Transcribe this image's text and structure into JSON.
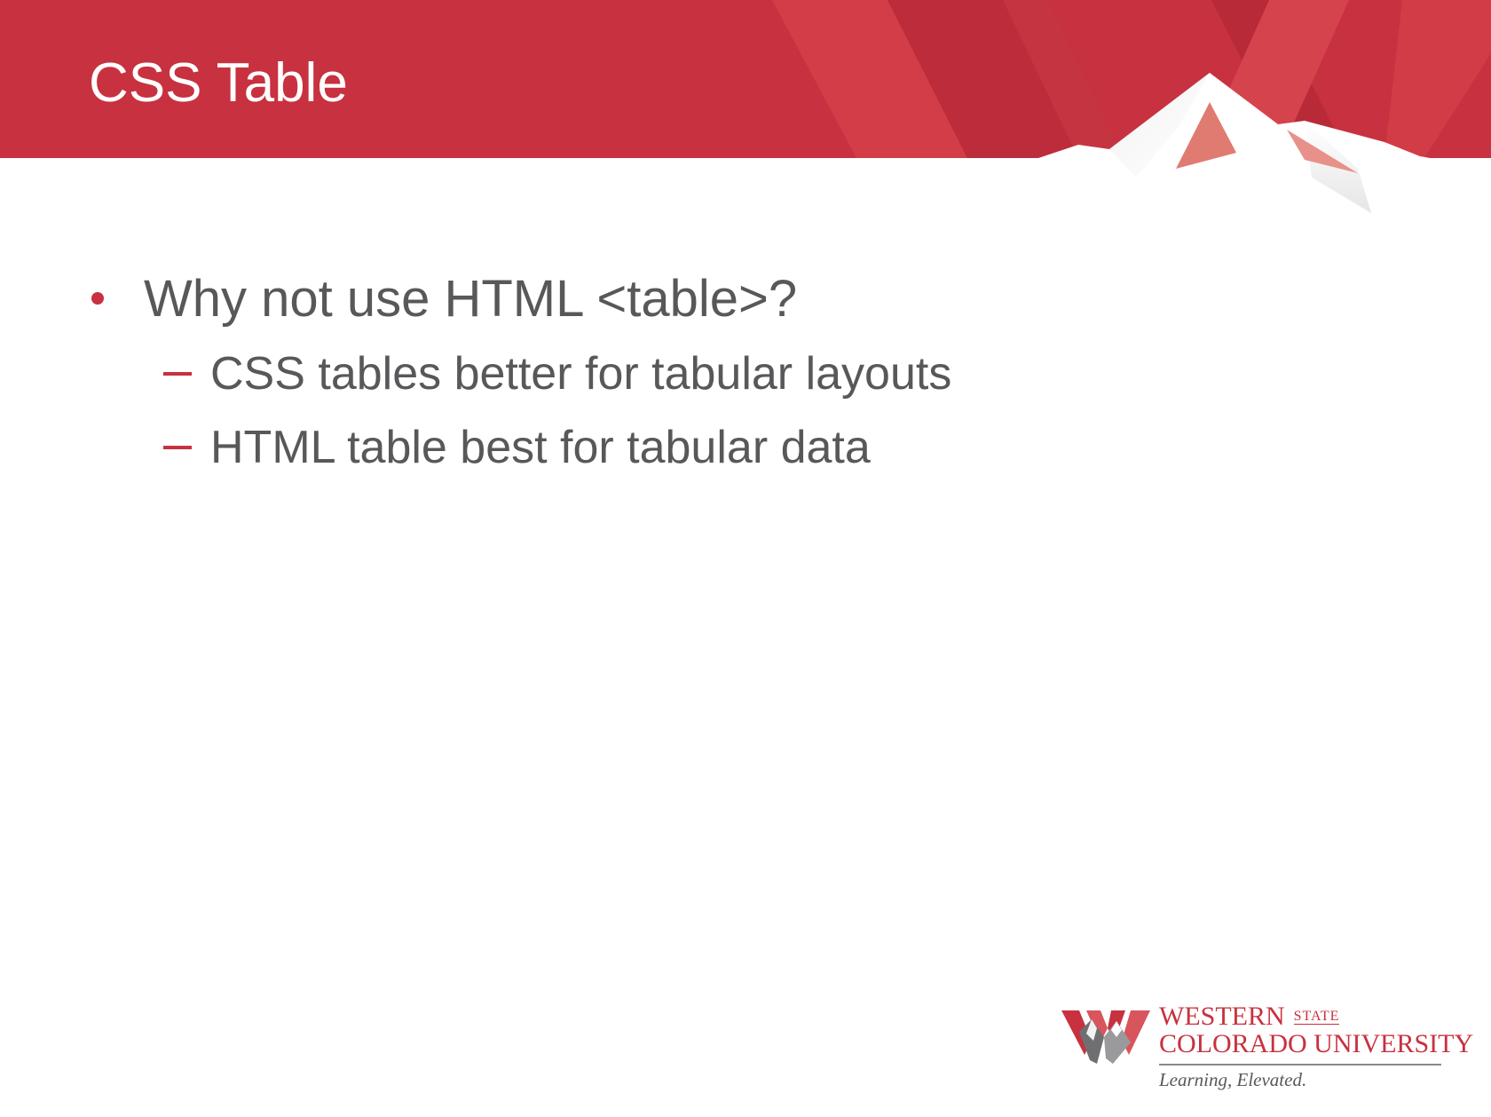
{
  "slide": {
    "title": "CSS Table",
    "bullets": [
      {
        "text": "Why not use HTML <table>?",
        "sub": [
          "CSS tables better for tabular layouts",
          "HTML table best for tabular data"
        ]
      }
    ]
  },
  "logo": {
    "line1": "WESTERN",
    "state": "STATE",
    "line2": "COLORADO UNIVERSITY",
    "tagline": "Learning, Elevated."
  },
  "colors": {
    "banner_red": "#c8313f",
    "accent_red": "#c8313f",
    "body_text": "#58585b",
    "background": "#ffffff"
  },
  "icons": {
    "logo_mark": "mountain-w-logo-icon",
    "header_art": "mountain-peak-banner"
  }
}
